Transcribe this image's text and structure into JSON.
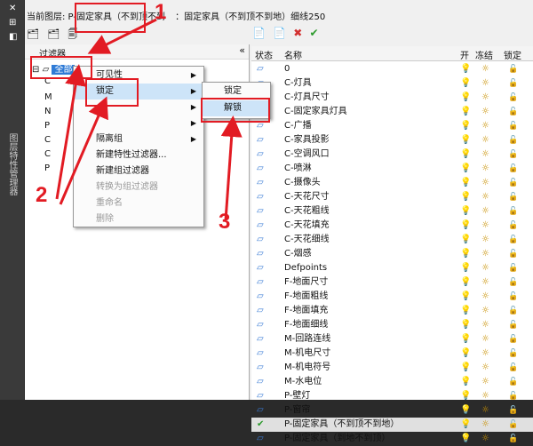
{
  "strip": {
    "glyphs": [
      "✕",
      "⊞",
      "◧"
    ],
    "vertical_text": "图层特性管理器"
  },
  "current_layer": {
    "label": "当前图层: P-固定家具（不到顶不到",
    "search": "：固定家具（不到顶不到地）细线250"
  },
  "toolbar_left": [
    "🗂",
    "🗂",
    "🗐"
  ],
  "toolbar_right": [
    "📄",
    "📄",
    "✖",
    "✔"
  ],
  "filter_panel": {
    "header": "过滤器",
    "collapse": "«",
    "root_label": "全部"
  },
  "tree_items": [
    "C",
    "M",
    "N",
    "P",
    "C",
    "C",
    "P",
    ""
  ],
  "menu1": [
    {
      "label": "可见性",
      "arrow": "▶",
      "disabled": false
    },
    {
      "label": "锁定",
      "arrow": "▶",
      "disabled": false
    },
    {
      "label": "",
      "arrow": "▶",
      "disabled": false
    },
    {
      "label": "",
      "arrow": "▶",
      "disabled": false
    },
    {
      "label": "隔离组",
      "arrow": "▶",
      "disabled": false
    },
    {
      "label": "新建特性过滤器...",
      "arrow": "",
      "disabled": false
    },
    {
      "label": "新建组过滤器",
      "arrow": "",
      "disabled": false
    },
    {
      "label": "转换为组过滤器",
      "arrow": "",
      "disabled": true
    },
    {
      "label": "重命名",
      "arrow": "",
      "disabled": true
    },
    {
      "label": "删除",
      "arrow": "",
      "disabled": true
    }
  ],
  "menu2": [
    "锁定",
    "解锁"
  ],
  "columns": {
    "status": "状态",
    "name": "名称",
    "on": "开",
    "freeze": "冻结",
    "lock": "锁定"
  },
  "layers": [
    {
      "status": "▱",
      "name": "0"
    },
    {
      "status": "▱",
      "name": "C-灯具"
    },
    {
      "status": "▱",
      "name": "C-灯具尺寸"
    },
    {
      "status": "▱",
      "name": "C-固定家具灯具"
    },
    {
      "status": "▱",
      "name": "C-广播"
    },
    {
      "status": "▱",
      "name": "C-家具投影"
    },
    {
      "status": "▱",
      "name": "C-空调风口"
    },
    {
      "status": "▱",
      "name": "C-喷淋"
    },
    {
      "status": "▱",
      "name": "C-摄像头"
    },
    {
      "status": "▱",
      "name": "C-天花尺寸"
    },
    {
      "status": "▱",
      "name": "C-天花粗线"
    },
    {
      "status": "▱",
      "name": "C-天花填充"
    },
    {
      "status": "▱",
      "name": "C-天花细线"
    },
    {
      "status": "▱",
      "name": "C-烟感"
    },
    {
      "status": "▱",
      "name": "Defpoints"
    },
    {
      "status": "▱",
      "name": "F-地面尺寸"
    },
    {
      "status": "▱",
      "name": "F-地面粗线"
    },
    {
      "status": "▱",
      "name": "F-地面填充"
    },
    {
      "status": "▱",
      "name": "F-地面细线"
    },
    {
      "status": "▱",
      "name": "M-回路连线"
    },
    {
      "status": "▱",
      "name": "M-机电尺寸"
    },
    {
      "status": "▱",
      "name": "M-机电符号"
    },
    {
      "status": "▱",
      "name": "M-水电位"
    },
    {
      "status": "▱",
      "name": "P-壁灯"
    },
    {
      "status": "▱",
      "name": "P-窗帘"
    },
    {
      "status": "✔",
      "name": "P-固定家具（不到顶不到地）"
    },
    {
      "status": "▱",
      "name": "P-固定家具（到地不到顶）"
    }
  ],
  "row_icons": {
    "on": "💡",
    "freeze": "☼",
    "lock": "🔓"
  },
  "annotations": {
    "one": "1",
    "two": "2",
    "three": "3"
  },
  "colors": {
    "accent": "#e21b23",
    "selection": "#2f7bd6",
    "menu_highlight": "#cde4f8"
  }
}
